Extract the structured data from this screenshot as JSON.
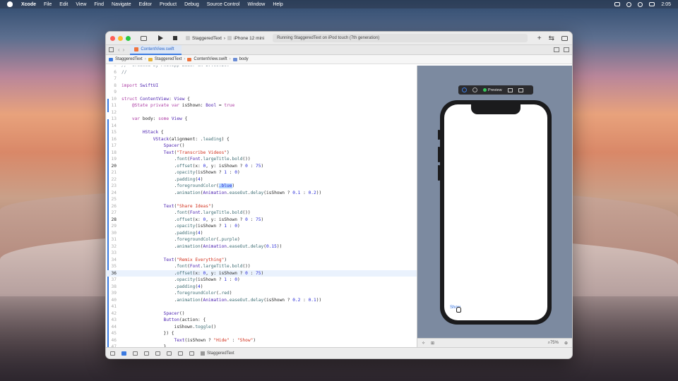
{
  "menubar": {
    "app": "Xcode",
    "items": [
      "File",
      "Edit",
      "View",
      "Find",
      "Navigate",
      "Editor",
      "Product",
      "Debug",
      "Source Control",
      "Window",
      "Help"
    ],
    "clock": "2:05"
  },
  "toolbar": {
    "scheme": "StaggeredText",
    "device": "iPhone 12 mini",
    "activity": "Running StaggeredText on iPod touch (7th generation)",
    "add": "+"
  },
  "tab": {
    "label": "ContentView.swift"
  },
  "jumpbar": [
    "StaggeredText",
    "StaggeredText",
    "ContentView.swift",
    "body"
  ],
  "editor": {
    "lines": [
      {
        "n": "5",
        "t": "//  Created by Philipp Bauer on 27.09.20."
      },
      {
        "n": "6",
        "t": "//"
      },
      {
        "n": "7",
        "t": ""
      },
      {
        "n": "8",
        "t": "import SwiftUI"
      },
      {
        "n": "9",
        "t": ""
      },
      {
        "n": "10",
        "t": "struct ContentView: View {"
      },
      {
        "n": "11",
        "t": "    @State private var isShown: Bool = true"
      },
      {
        "n": "12",
        "t": ""
      },
      {
        "n": "13",
        "t": "    var body: some View {"
      },
      {
        "n": "14",
        "t": ""
      },
      {
        "n": "15",
        "t": "        HStack {"
      },
      {
        "n": "16",
        "t": "            VStack(alignment: .leading) {"
      },
      {
        "n": "17",
        "t": "                Spacer()"
      },
      {
        "n": "18",
        "t": "                Text(\"Transcribe Videos\")"
      },
      {
        "n": "19",
        "t": "                    .font(Font.largeTitle.bold())"
      },
      {
        "n": "20",
        "t": "                    .offset(x: 0, y: isShown ? 0 : 75)"
      },
      {
        "n": "21",
        "t": "                    .opacity(isShown ? 1 : 0)"
      },
      {
        "n": "22",
        "t": "                    .padding(4)"
      },
      {
        "n": "23",
        "t": "                    .foregroundColor(.blue)"
      },
      {
        "n": "24",
        "t": "                    .animation(Animation.easeOut.delay(isShown ? 0.1 : 0.2))"
      },
      {
        "n": "25",
        "t": ""
      },
      {
        "n": "26",
        "t": "                Text(\"Share Ideas\")"
      },
      {
        "n": "27",
        "t": "                    .font(Font.largeTitle.bold())"
      },
      {
        "n": "28",
        "t": "                    .offset(x: 0, y: isShown ? 0 : 75)"
      },
      {
        "n": "29",
        "t": "                    .opacity(isShown ? 1 : 0)"
      },
      {
        "n": "30",
        "t": "                    .padding(4)"
      },
      {
        "n": "31",
        "t": "                    .foregroundColor(.purple)"
      },
      {
        "n": "32",
        "t": "                    .animation(Animation.easeOut.delay(0.15))"
      },
      {
        "n": "33",
        "t": ""
      },
      {
        "n": "34",
        "t": "                Text(\"Remix Everything\")"
      },
      {
        "n": "35",
        "t": "                    .font(Font.largeTitle.bold())"
      },
      {
        "n": "36",
        "t": "                    .offset(x: 0, y: isShown ? 0 : 75)"
      },
      {
        "n": "37",
        "t": "                    .opacity(isShown ? 1 : 0)"
      },
      {
        "n": "38",
        "t": "                    .padding(4)"
      },
      {
        "n": "39",
        "t": "                    .foregroundColor(.red)"
      },
      {
        "n": "40",
        "t": "                    .animation(Animation.easeOut.delay(isShown ? 0.2 : 0.1))"
      },
      {
        "n": "41",
        "t": ""
      },
      {
        "n": "42",
        "t": "                Spacer()"
      },
      {
        "n": "43",
        "t": "                Button(action: {"
      },
      {
        "n": "44",
        "t": "                    isShown.toggle()"
      },
      {
        "n": "45",
        "t": "                }) {"
      },
      {
        "n": "46",
        "t": "                    Text(isShown ? \"Hide\" : \"Show\")"
      },
      {
        "n": "47",
        "t": "                }"
      }
    ],
    "current_line": "36",
    "selected_token": ".blue"
  },
  "preview": {
    "label": "Preview",
    "show_button": "Show",
    "zoom": "75%"
  },
  "statusbar": {
    "target": "StaggeredText"
  }
}
